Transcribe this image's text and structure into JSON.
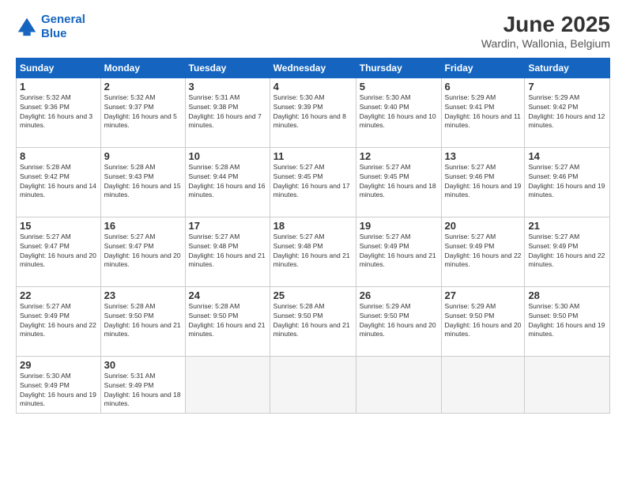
{
  "header": {
    "logo_line1": "General",
    "logo_line2": "Blue",
    "title": "June 2025",
    "subtitle": "Wardin, Wallonia, Belgium"
  },
  "days_of_week": [
    "Sunday",
    "Monday",
    "Tuesday",
    "Wednesday",
    "Thursday",
    "Friday",
    "Saturday"
  ],
  "weeks": [
    [
      {
        "num": "1",
        "rise": "Sunrise: 5:32 AM",
        "set": "Sunset: 9:36 PM",
        "daylight": "Daylight: 16 hours and 3 minutes."
      },
      {
        "num": "2",
        "rise": "Sunrise: 5:32 AM",
        "set": "Sunset: 9:37 PM",
        "daylight": "Daylight: 16 hours and 5 minutes."
      },
      {
        "num": "3",
        "rise": "Sunrise: 5:31 AM",
        "set": "Sunset: 9:38 PM",
        "daylight": "Daylight: 16 hours and 7 minutes."
      },
      {
        "num": "4",
        "rise": "Sunrise: 5:30 AM",
        "set": "Sunset: 9:39 PM",
        "daylight": "Daylight: 16 hours and 8 minutes."
      },
      {
        "num": "5",
        "rise": "Sunrise: 5:30 AM",
        "set": "Sunset: 9:40 PM",
        "daylight": "Daylight: 16 hours and 10 minutes."
      },
      {
        "num": "6",
        "rise": "Sunrise: 5:29 AM",
        "set": "Sunset: 9:41 PM",
        "daylight": "Daylight: 16 hours and 11 minutes."
      },
      {
        "num": "7",
        "rise": "Sunrise: 5:29 AM",
        "set": "Sunset: 9:42 PM",
        "daylight": "Daylight: 16 hours and 12 minutes."
      }
    ],
    [
      {
        "num": "8",
        "rise": "Sunrise: 5:28 AM",
        "set": "Sunset: 9:42 PM",
        "daylight": "Daylight: 16 hours and 14 minutes."
      },
      {
        "num": "9",
        "rise": "Sunrise: 5:28 AM",
        "set": "Sunset: 9:43 PM",
        "daylight": "Daylight: 16 hours and 15 minutes."
      },
      {
        "num": "10",
        "rise": "Sunrise: 5:28 AM",
        "set": "Sunset: 9:44 PM",
        "daylight": "Daylight: 16 hours and 16 minutes."
      },
      {
        "num": "11",
        "rise": "Sunrise: 5:27 AM",
        "set": "Sunset: 9:45 PM",
        "daylight": "Daylight: 16 hours and 17 minutes."
      },
      {
        "num": "12",
        "rise": "Sunrise: 5:27 AM",
        "set": "Sunset: 9:45 PM",
        "daylight": "Daylight: 16 hours and 18 minutes."
      },
      {
        "num": "13",
        "rise": "Sunrise: 5:27 AM",
        "set": "Sunset: 9:46 PM",
        "daylight": "Daylight: 16 hours and 19 minutes."
      },
      {
        "num": "14",
        "rise": "Sunrise: 5:27 AM",
        "set": "Sunset: 9:46 PM",
        "daylight": "Daylight: 16 hours and 19 minutes."
      }
    ],
    [
      {
        "num": "15",
        "rise": "Sunrise: 5:27 AM",
        "set": "Sunset: 9:47 PM",
        "daylight": "Daylight: 16 hours and 20 minutes."
      },
      {
        "num": "16",
        "rise": "Sunrise: 5:27 AM",
        "set": "Sunset: 9:47 PM",
        "daylight": "Daylight: 16 hours and 20 minutes."
      },
      {
        "num": "17",
        "rise": "Sunrise: 5:27 AM",
        "set": "Sunset: 9:48 PM",
        "daylight": "Daylight: 16 hours and 21 minutes."
      },
      {
        "num": "18",
        "rise": "Sunrise: 5:27 AM",
        "set": "Sunset: 9:48 PM",
        "daylight": "Daylight: 16 hours and 21 minutes."
      },
      {
        "num": "19",
        "rise": "Sunrise: 5:27 AM",
        "set": "Sunset: 9:49 PM",
        "daylight": "Daylight: 16 hours and 21 minutes."
      },
      {
        "num": "20",
        "rise": "Sunrise: 5:27 AM",
        "set": "Sunset: 9:49 PM",
        "daylight": "Daylight: 16 hours and 22 minutes."
      },
      {
        "num": "21",
        "rise": "Sunrise: 5:27 AM",
        "set": "Sunset: 9:49 PM",
        "daylight": "Daylight: 16 hours and 22 minutes."
      }
    ],
    [
      {
        "num": "22",
        "rise": "Sunrise: 5:27 AM",
        "set": "Sunset: 9:49 PM",
        "daylight": "Daylight: 16 hours and 22 minutes."
      },
      {
        "num": "23",
        "rise": "Sunrise: 5:28 AM",
        "set": "Sunset: 9:50 PM",
        "daylight": "Daylight: 16 hours and 21 minutes."
      },
      {
        "num": "24",
        "rise": "Sunrise: 5:28 AM",
        "set": "Sunset: 9:50 PM",
        "daylight": "Daylight: 16 hours and 21 minutes."
      },
      {
        "num": "25",
        "rise": "Sunrise: 5:28 AM",
        "set": "Sunset: 9:50 PM",
        "daylight": "Daylight: 16 hours and 21 minutes."
      },
      {
        "num": "26",
        "rise": "Sunrise: 5:29 AM",
        "set": "Sunset: 9:50 PM",
        "daylight": "Daylight: 16 hours and 20 minutes."
      },
      {
        "num": "27",
        "rise": "Sunrise: 5:29 AM",
        "set": "Sunset: 9:50 PM",
        "daylight": "Daylight: 16 hours and 20 minutes."
      },
      {
        "num": "28",
        "rise": "Sunrise: 5:30 AM",
        "set": "Sunset: 9:50 PM",
        "daylight": "Daylight: 16 hours and 19 minutes."
      }
    ],
    [
      {
        "num": "29",
        "rise": "Sunrise: 5:30 AM",
        "set": "Sunset: 9:49 PM",
        "daylight": "Daylight: 16 hours and 19 minutes."
      },
      {
        "num": "30",
        "rise": "Sunrise: 5:31 AM",
        "set": "Sunset: 9:49 PM",
        "daylight": "Daylight: 16 hours and 18 minutes."
      },
      null,
      null,
      null,
      null,
      null
    ]
  ]
}
